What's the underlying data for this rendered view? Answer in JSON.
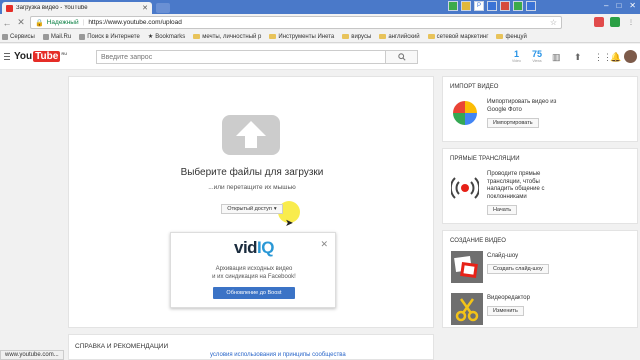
{
  "browser": {
    "tab_title": "Загрузка видео - YouTube",
    "url": "https://www.youtube.com/upload",
    "secure_label": "Надежный",
    "bookmarks": [
      "Сервисы",
      "Mail.Ru",
      "Поиск в Интернете",
      "Bookmarks",
      "мечты, личностный р",
      "Инструменты Инета",
      "вирусы",
      "английский",
      "сетевой маркетинг",
      "фенцуй"
    ]
  },
  "masthead": {
    "logo_you": "You",
    "logo_tube": "Tube",
    "logo_region": "RU",
    "search_placeholder": "Введите запрос",
    "stat1_value": "1",
    "stat1_label": "Video",
    "stat2_value": "75",
    "stat2_label": "Views"
  },
  "upload": {
    "title": "Выберите файлы для загрузки",
    "subtitle": "...или перетащите их мышью",
    "privacy": "Открытый доступ"
  },
  "vidiq": {
    "logo_vid": "vid",
    "logo_iq": "IQ",
    "text_line1": "Архивация исходных видео",
    "text_line2": "и их синдикация на Facebook!",
    "button": "Обновление до Boost"
  },
  "help": {
    "title": "СПРАВКА И РЕКОМЕНДАЦИИ"
  },
  "status": {
    "text": "www.youtube.com...",
    "policy": "условия использования и принципы сообщества"
  },
  "sidebar": {
    "import": {
      "title": "ИМПОРТ ВИДЕО",
      "text": "Импортировать видео из Google Фото",
      "button": "Импортировать"
    },
    "live": {
      "title": "ПРЯМЫЕ ТРАНСЛЯЦИИ",
      "text": "Проводите прямые трансляции, чтобы наладить общение с поклонниками",
      "button": "Начать"
    },
    "create": {
      "title": "СОЗДАНИЕ ВИДЕО",
      "slideshow_label": "Слайд-шоу",
      "slideshow_button": "Создать слайд-шоу",
      "editor_label": "Видеоредактор",
      "editor_button": "Изменить"
    }
  }
}
